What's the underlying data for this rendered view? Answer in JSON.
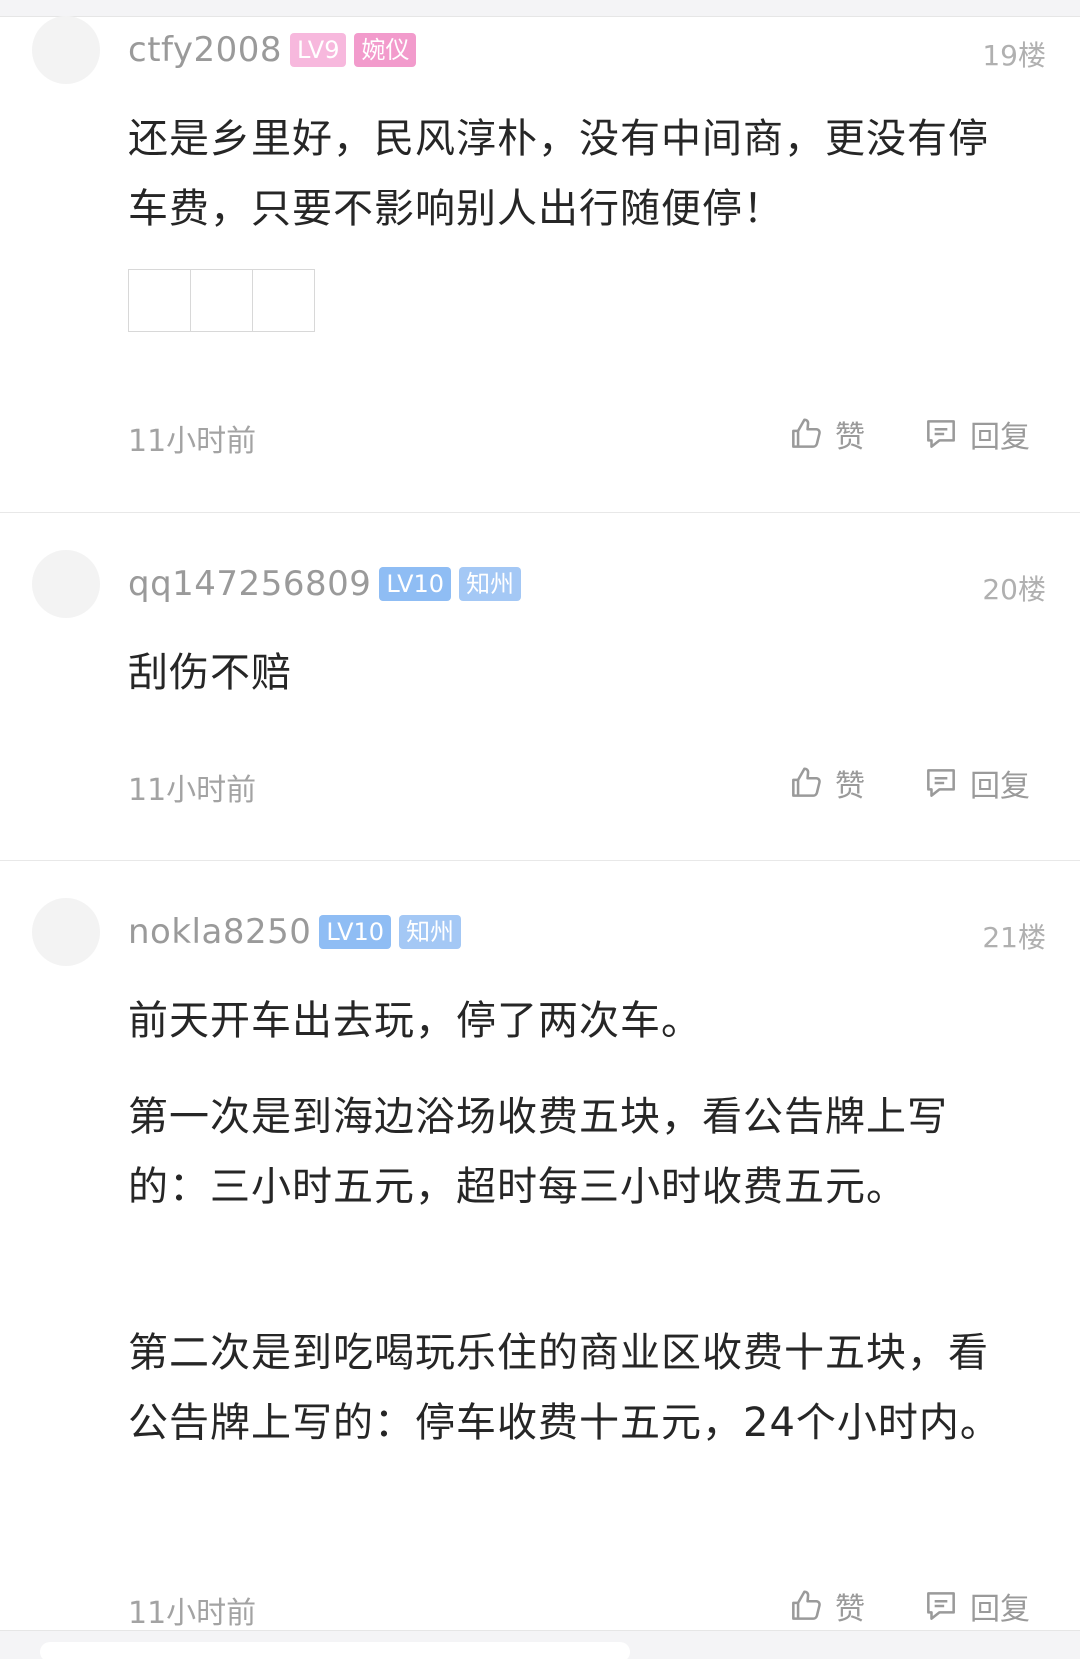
{
  "comments": [
    {
      "username": "ctfy2008",
      "level": "LV9",
      "title": "婉仪",
      "level_color": "#f7a8d6",
      "title_color": "#f08fc8",
      "floor": "19楼",
      "paragraphs": [
        "还是乡里好，民风淳朴，没有中间商，更没有停车费，只要不影响别人出行随便停！"
      ],
      "time": "11小时前",
      "like_label": "赞",
      "reply_label": "回复"
    },
    {
      "username": "qq147256809",
      "level": "LV10",
      "title": "知州",
      "level_color": "#8fbdf4",
      "title_color": "#a4c8f5",
      "floor": "20楼",
      "paragraphs": [
        "刮伤不赔"
      ],
      "time": "11小时前",
      "like_label": "赞",
      "reply_label": "回复"
    },
    {
      "username": "nokla8250",
      "level": "LV10",
      "title": "知州",
      "level_color": "#8fbdf4",
      "title_color": "#a4c8f5",
      "floor": "21楼",
      "paragraphs": [
        "前天开车出去玩，停了两次车。",
        "第一次是到海边浴场收费五块，看公告牌上写的：三小时五元，超时每三小时收费五元。",
        "第二次是到吃喝玩乐住的商业区收费十五块，看公告牌上写的：停车收费十五元，24个小时内。"
      ],
      "time": "11小时前",
      "like_label": "赞",
      "reply_label": "回复"
    }
  ],
  "icons": {
    "like": "thumbs-up-icon",
    "reply": "comment-bubble-icon"
  }
}
